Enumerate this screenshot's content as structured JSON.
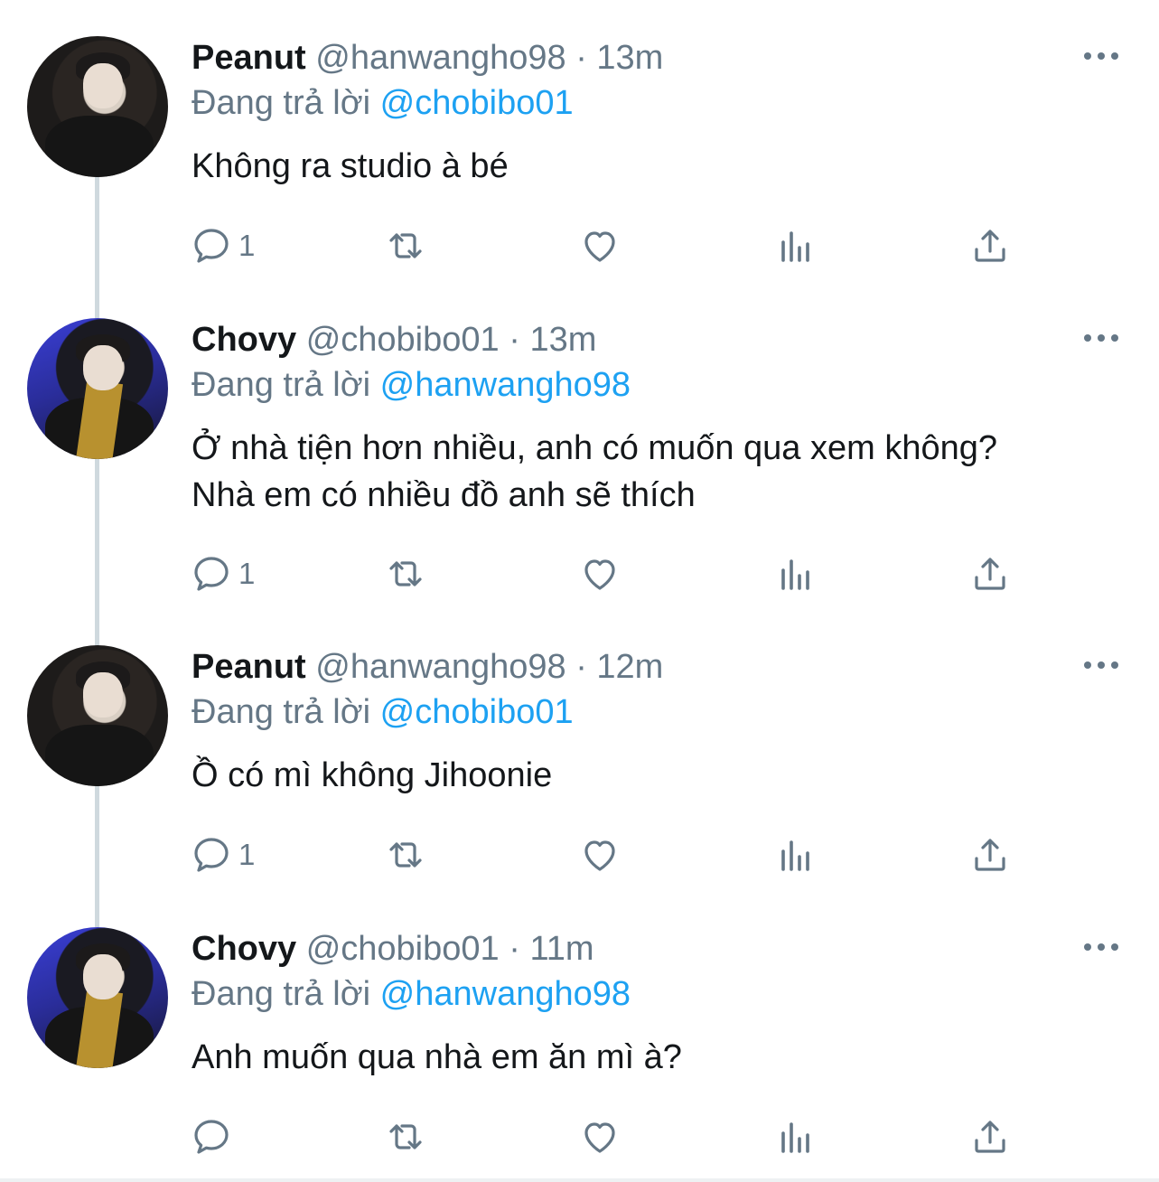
{
  "reply_prefix": "Đang trả lời",
  "tweets": [
    {
      "name": "Peanut",
      "handle": "@hanwangho98",
      "dot": "·",
      "time": "13m",
      "reply_to": "@chobibo01",
      "text": "Không ra studio à bé",
      "reply_count": "1",
      "avatar": "peanut-avatar"
    },
    {
      "name": "Chovy",
      "handle": "@chobibo01",
      "dot": "·",
      "time": "13m",
      "reply_to": "@hanwangho98",
      "text": "Ở nhà tiện hơn nhiều, anh có muốn qua xem không?\nNhà em có nhiều đồ anh sẽ thích",
      "reply_count": "1",
      "avatar": "chovy-avatar"
    },
    {
      "name": "Peanut",
      "handle": "@hanwangho98",
      "dot": "·",
      "time": "12m",
      "reply_to": "@chobibo01",
      "text": "Ồ có mì không Jihoonie",
      "reply_count": "1",
      "avatar": "peanut-avatar"
    },
    {
      "name": "Chovy",
      "handle": "@chobibo01",
      "dot": "·",
      "time": "11m",
      "reply_to": "@hanwangho98",
      "text": "Anh muốn qua nhà em ăn mì à?",
      "reply_count": "",
      "avatar": "chovy-avatar"
    }
  ],
  "icons": {
    "reply": "reply-icon",
    "retweet": "retweet-icon",
    "like": "heart-icon",
    "analytics": "analytics-icon",
    "share": "share-icon",
    "more": "more-icon"
  },
  "colors": {
    "text": "#14171a",
    "secondary": "#657786",
    "mention": "#1da1f2",
    "thread_line": "#cfd9de"
  }
}
